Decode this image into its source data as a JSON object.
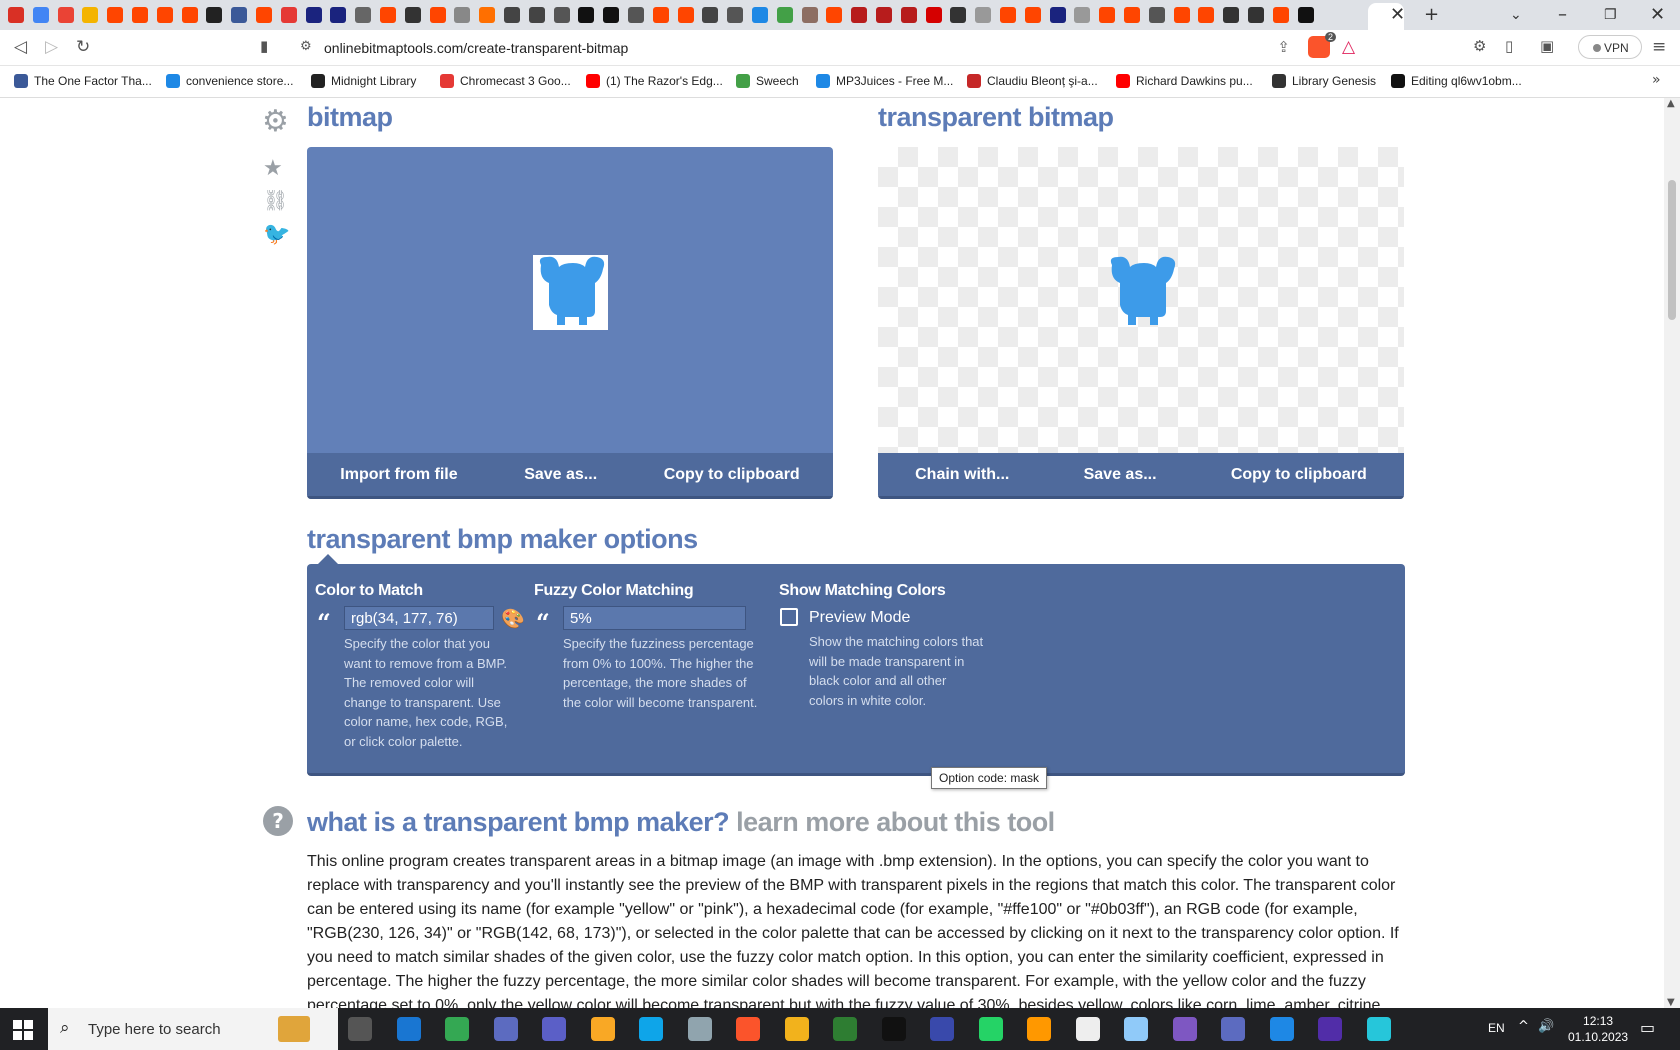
{
  "browser": {
    "tab_title": "",
    "url": "onlinebitmaptools.com/create-transparent-bitmap",
    "vpn_label": "VPN",
    "brave_badge": "2",
    "bookmarks": [
      {
        "label": "The One Factor Tha...",
        "icon_color": "#3b5998"
      },
      {
        "label": "convenience store...",
        "icon_color": "#1e88e5"
      },
      {
        "label": "Midnight Library",
        "icon_color": "#222222"
      },
      {
        "label": "Chromecast 3 Goo...",
        "icon_color": "#e53935"
      },
      {
        "label": "(1) The Razor's Edg...",
        "icon_color": "#ff0000"
      },
      {
        "label": "Sweech",
        "icon_color": "#43a047"
      },
      {
        "label": "MP3Juices - Free M...",
        "icon_color": "#1e88e5"
      },
      {
        "label": "Claudiu Bleonț şi-a...",
        "icon_color": "#c62828"
      },
      {
        "label": "Richard Dawkins pu...",
        "icon_color": "#ff0000"
      },
      {
        "label": "Library Genesis",
        "icon_color": "#333333"
      },
      {
        "label": "Editing ql6wv1obm...",
        "icon_color": "#111111"
      }
    ]
  },
  "page": {
    "sidebar_icons": [
      "gear-icon",
      "star-icon",
      "link-icon",
      "twitter-icon"
    ],
    "input_panel": {
      "title": "bitmap",
      "bg_color": "#6280b8",
      "buttons": [
        "Import from file",
        "Save as...",
        "Copy to clipboard"
      ]
    },
    "output_panel": {
      "title": "transparent bitmap",
      "buttons": [
        "Chain with...",
        "Save as...",
        "Copy to clipboard"
      ]
    },
    "options": {
      "title": "transparent bmp maker options",
      "color_to_match": {
        "heading": "Color to Match",
        "value": "rgb(34, 177, 76)",
        "help": "Specify the color that you want to remove from a BMP. The removed color will change to transparent. Use color name, hex code, RGB, or click color palette."
      },
      "fuzzy": {
        "heading": "Fuzzy Color Matching",
        "value": "5%",
        "help": "Specify the fuzziness percentage from 0% to 100%. The higher the percentage, the more shades of the color will become transparent."
      },
      "show_matching": {
        "heading": "Show Matching Colors",
        "checkbox_label": "Preview Mode",
        "checked": false,
        "help": "Show the matching colors that will be made transparent in black color and all other colors in white color.",
        "tooltip": "Option code: mask"
      }
    },
    "about": {
      "title": "what is a transparent bmp maker?",
      "subtitle": "learn more about this tool",
      "text": "This online program creates transparent areas in a bitmap image (an image with .bmp extension). In the options, you can specify the color you want to replace with transparency and you'll instantly see the preview of the BMP with transparent pixels in the regions that match this color. The transparent color can be entered using its name (for example \"yellow\" or \"pink\"), a hexadecimal code (for example, \"#ffe100\" or \"#0b03ff\"), an RGB code (for example, \"RGB(230, 126, 34)\" or \"RGB(142, 68, 173)\"), or selected in the color palette that can be accessed by clicking on it next to the transparency color option. If you need to match similar shades of the given color, use the fuzzy color match option. In this option, you can enter the similarity coefficient, expressed in percentage. The higher the fuzzy percentage, the more similar color shades will become transparent. For example, with the yellow color and the fuzzy percentage set to 0%, only the yellow color will become transparent but with the fuzzy value of 30%, besides yellow, colors like corn, lime, amber, citrine, and"
    }
  },
  "taskbar": {
    "search_placeholder": "Type here to search",
    "language": "EN",
    "time": "12:13",
    "date": "01.10.2023"
  }
}
